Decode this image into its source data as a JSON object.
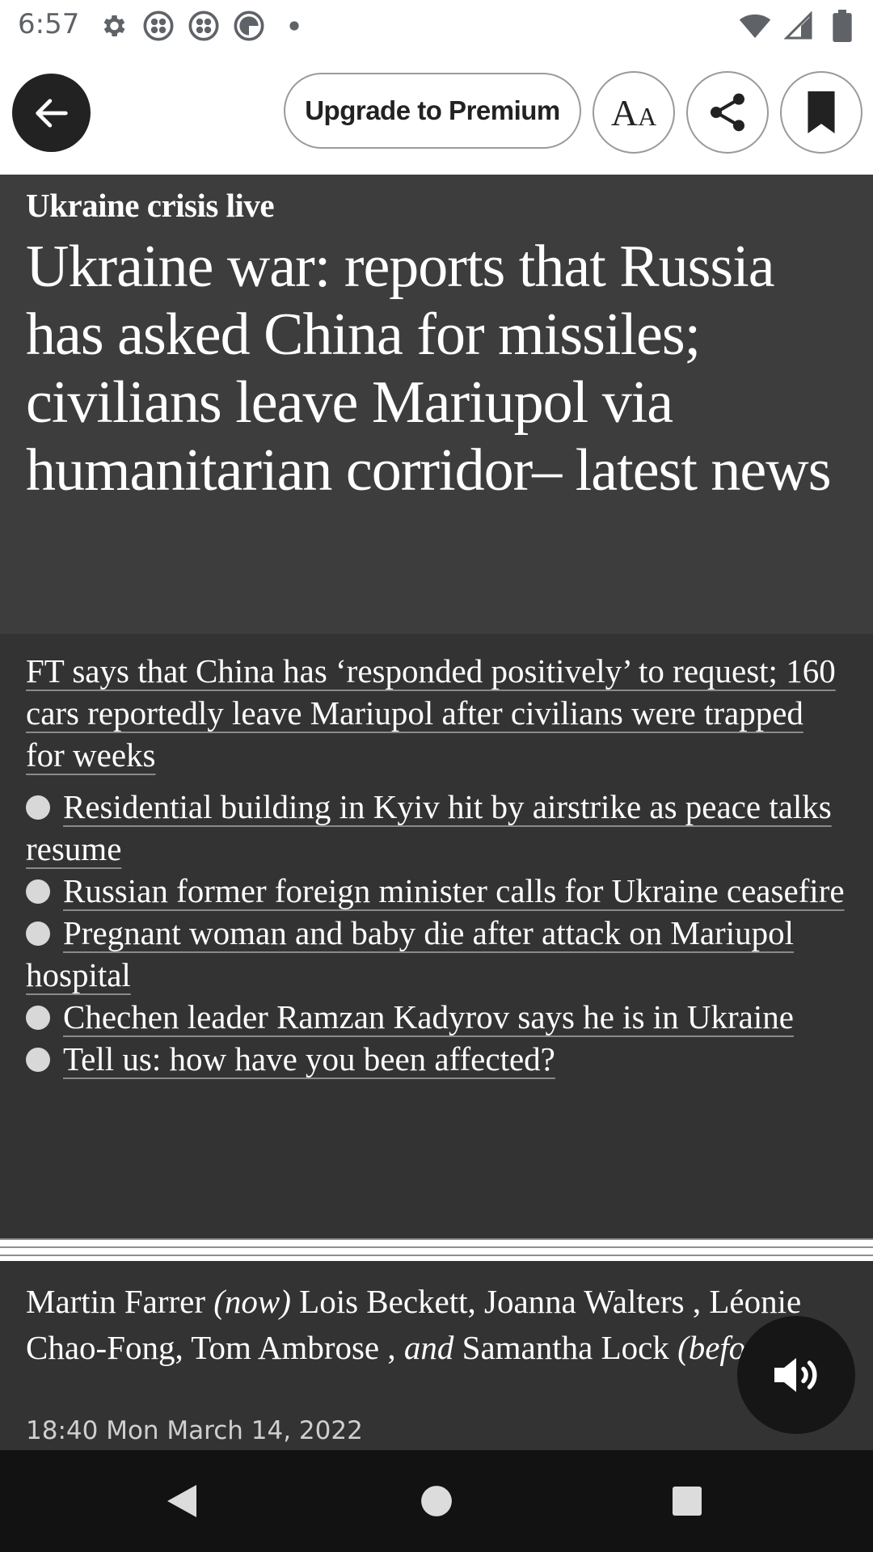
{
  "status_bar": {
    "time": "6:57",
    "left_icons": [
      "gear-icon",
      "app-icon",
      "app-icon",
      "data-saver-icon",
      "dot-icon"
    ],
    "right_icons": [
      "wifi-icon",
      "signal-icon",
      "battery-icon"
    ]
  },
  "toolbar": {
    "upgrade_label": "Upgrade to Premium",
    "text_size_label": "AA"
  },
  "article": {
    "kicker": "Ukraine crisis live",
    "headline": "Ukraine war: reports that Russia has asked China for missiles; civilians leave Mariupol via humanitarian corridor– latest news",
    "standfirst_intro": "FT says that China has ‘responded positively’ to request; 160 cars reportedly leave Mariupol after civilians were trapped for weeks",
    "bullets": [
      "Residential building in Kyiv hit by airstrike as peace talks resume",
      "Russian former foreign minister calls for Ukraine ceasefire",
      "Pregnant woman and baby die after attack on Mariupol hospital",
      "Chechen leader Ramzan Kadyrov says he is in Ukraine",
      "Tell us: how have you been affected?"
    ],
    "byline": {
      "author_now": "Martin Farrer",
      "now_label": "(now)",
      "authors_before": "Lois Beckett, Joanna Walters , Léonie Chao-Fong, Tom Ambrose ,",
      "and_label": "and",
      "last_author": "Samantha Lock",
      "before_label": "(before)"
    },
    "dateline": "18:40 Mon March 14, 2022"
  },
  "colors": {
    "headline_bg": "#3d3d3d",
    "standfirst_bg": "#333333",
    "nav_bg": "#121212"
  }
}
